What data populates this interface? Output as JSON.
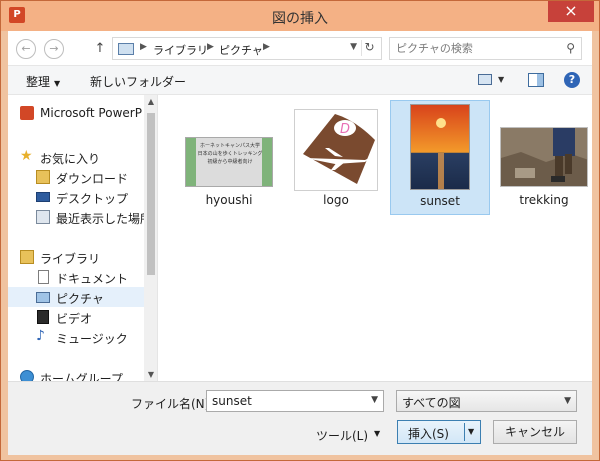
{
  "window": {
    "title": "図の挿入",
    "app_icon_letter": "P",
    "close_glyph": "×"
  },
  "nav": {
    "back_glyph": "←",
    "forward_glyph": "→",
    "up_glyph": "↑",
    "breadcrumb": [
      "ライブラリ",
      "ピクチャ"
    ],
    "crumb_sep": "▶",
    "dropdown_glyph": "▼",
    "refresh_glyph": "↻",
    "search_placeholder": "ピクチャの検索",
    "search_glyph": "⚲"
  },
  "toolbar": {
    "organize_label": "整理",
    "new_folder_label": "新しいフォルダー",
    "caret": "▼",
    "help_glyph": "?"
  },
  "navpane": {
    "items": [
      {
        "label": "Microsoft PowerP",
        "icon": "powerpoint-icon",
        "indent": 0
      },
      {
        "label": "お気に入り",
        "icon": "star-icon",
        "indent": 0
      },
      {
        "label": "ダウンロード",
        "icon": "download-folder-icon",
        "indent": 1
      },
      {
        "label": "デスクトップ",
        "icon": "desktop-icon",
        "indent": 1
      },
      {
        "label": "最近表示した場所",
        "icon": "recent-places-icon",
        "indent": 1
      },
      {
        "label": "ライブラリ",
        "icon": "library-icon",
        "indent": 0
      },
      {
        "label": "ドキュメント",
        "icon": "documents-icon",
        "indent": 1
      },
      {
        "label": "ピクチャ",
        "icon": "pictures-icon",
        "indent": 1,
        "selected": true
      },
      {
        "label": "ビデオ",
        "icon": "videos-icon",
        "indent": 1
      },
      {
        "label": "ミュージック",
        "icon": "music-icon",
        "indent": 1
      },
      {
        "label": "ホームグループ",
        "icon": "homegroup-icon",
        "indent": 0
      }
    ],
    "scroll_up": "▲",
    "scroll_down": "▼"
  },
  "files": [
    {
      "name": "hyoushi",
      "thumb_text": [
        "ホーネットキャンパス大学",
        "日本の山を歩くトレッキング",
        "初級から中級者向け"
      ]
    },
    {
      "name": "logo",
      "thumb_letter": "D"
    },
    {
      "name": "sunset",
      "selected": true
    },
    {
      "name": "trekking"
    }
  ],
  "bottom": {
    "filename_label": "ファイル名(N):",
    "filename_value": "sunset",
    "filetype_value": "すべての図",
    "tools_label": "ツール(L)",
    "insert_label": "挿入(S)",
    "cancel_label": "キャンセル",
    "caret": "▼"
  },
  "colors": {
    "title_bar": "#f4b185",
    "close_button": "#c7413a",
    "selection": "#cce4f7",
    "logo_bg": "#7a4a2f",
    "logo_letter": "#e86fb5"
  }
}
